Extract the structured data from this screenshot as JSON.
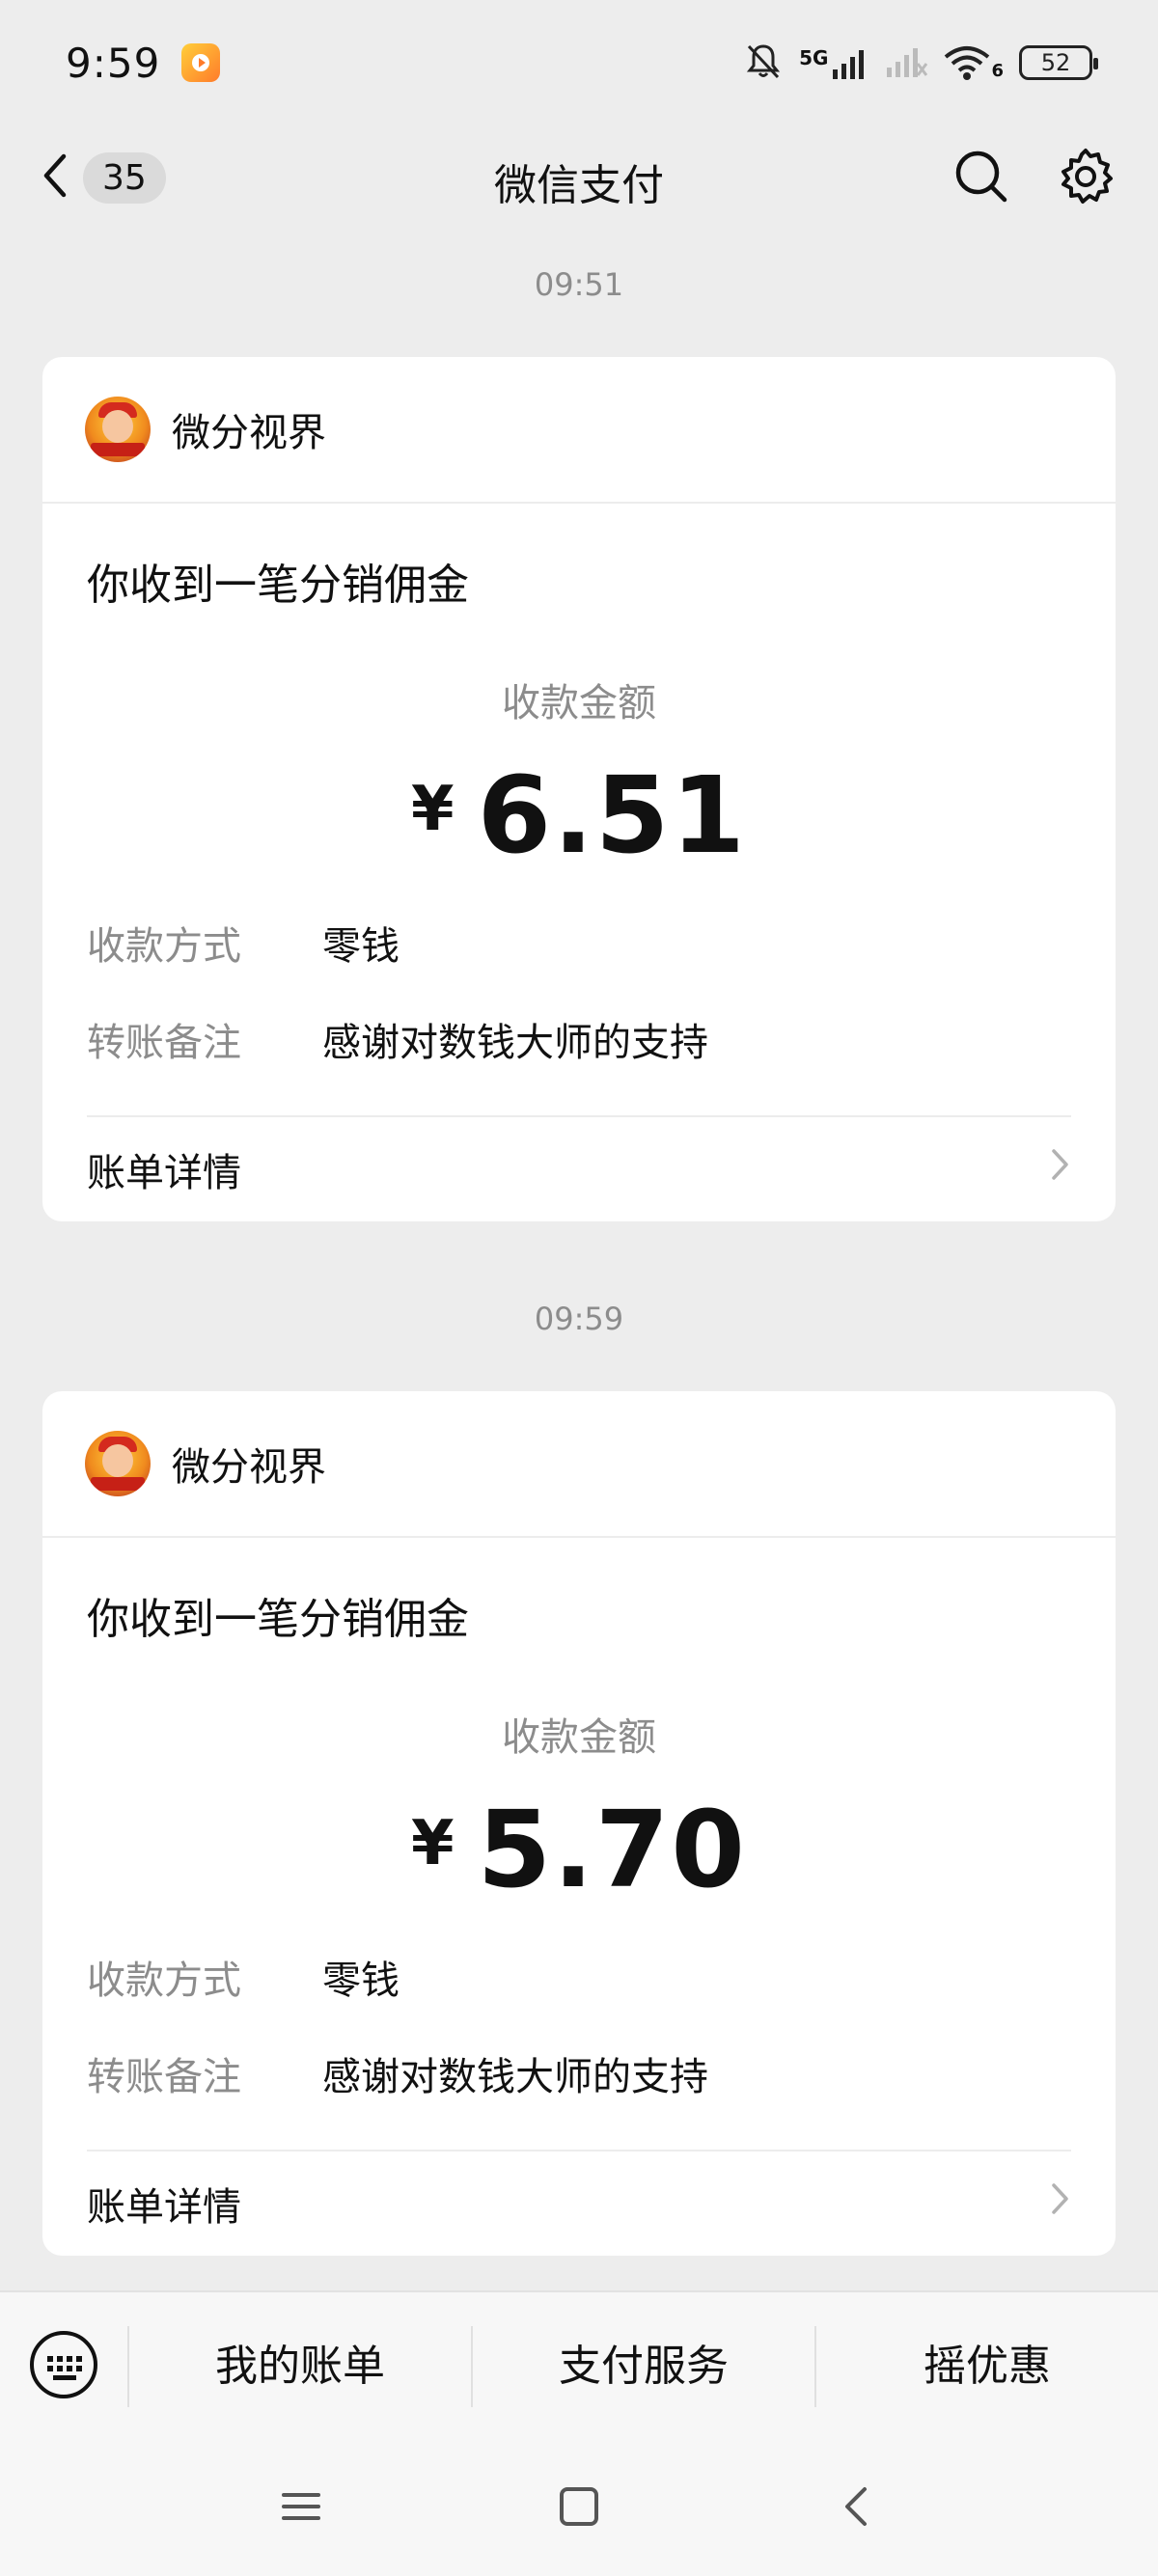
{
  "status_bar": {
    "time": "9:59",
    "network": "5G",
    "wifi_sub": "6",
    "battery": "52"
  },
  "nav": {
    "unread_count": "35",
    "title": "微信支付"
  },
  "messages": [
    {
      "time": "09:51",
      "merchant": "微分视界",
      "title": "你收到一笔分销佣金",
      "amount_label": "收款金额",
      "currency": "¥",
      "amount": "6.51",
      "method_label": "收款方式",
      "method_value": "零钱",
      "note_label": "转账备注",
      "note_value": "感谢对数钱大师的支持",
      "bill_detail": "账单详情"
    },
    {
      "time": "09:59",
      "merchant": "微分视界",
      "title": "你收到一笔分销佣金",
      "amount_label": "收款金额",
      "currency": "¥",
      "amount": "5.70",
      "method_label": "收款方式",
      "method_value": "零钱",
      "note_label": "转账备注",
      "note_value": "感谢对数钱大师的支持",
      "bill_detail": "账单详情"
    }
  ],
  "bottom_menu": {
    "items": [
      "我的账单",
      "支付服务",
      "摇优惠"
    ]
  },
  "icons": {
    "back": "chevron-left-icon",
    "search": "search-icon",
    "settings": "gear-icon",
    "keyboard": "keyboard-icon",
    "chevron": "chevron-right-icon",
    "recents": "menu-icon",
    "home": "home-square-icon",
    "system_back": "back-triangle-icon"
  }
}
